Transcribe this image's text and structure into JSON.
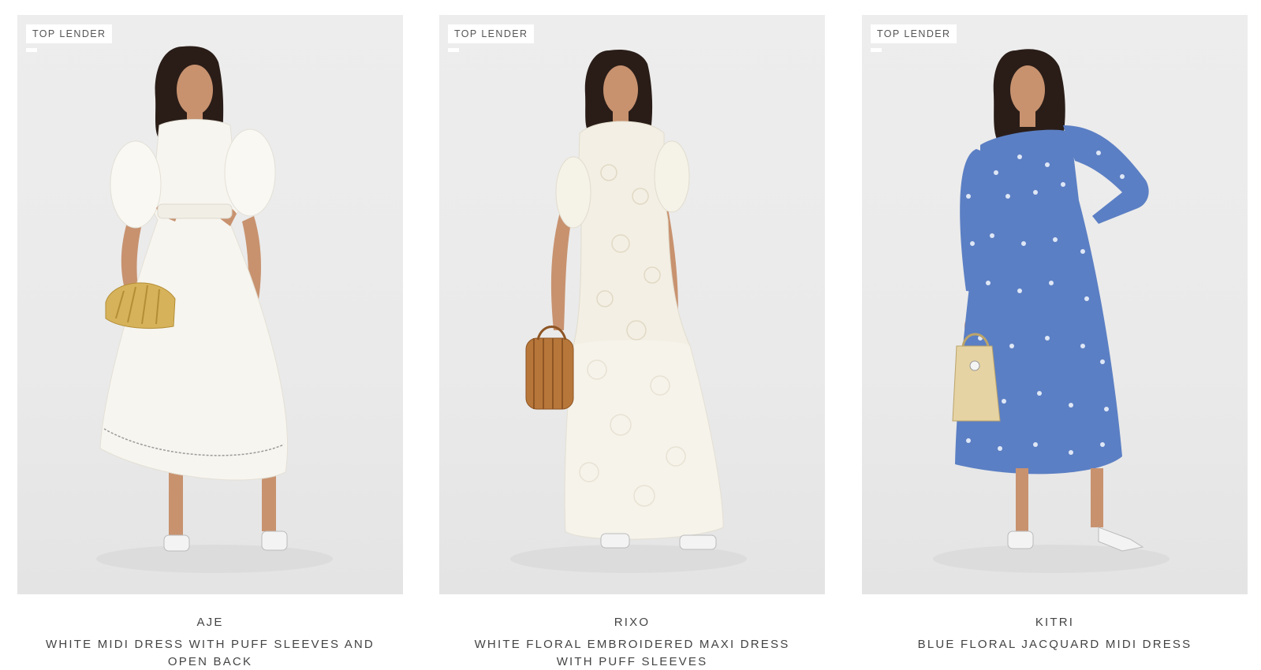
{
  "products": [
    {
      "badge": "TOP LENDER",
      "brand": "AJE",
      "title": "WHITE MIDI DRESS WITH PUFF SLEEVES AND OPEN BACK",
      "dress_color": "#f7f5ef",
      "accessory": "gold-shell-clutch"
    },
    {
      "badge": "TOP LENDER",
      "brand": "RIXO",
      "title": "WHITE FLORAL EMBROIDERED MAXI DRESS WITH PUFF SLEEVES",
      "dress_color": "#f3efe4",
      "accessory": "bamboo-basket-bag"
    },
    {
      "badge": "TOP LENDER",
      "brand": "KITRI",
      "title": "BLUE FLORAL JACQUARD MIDI DRESS",
      "dress_color": "#5b7fc4",
      "accessory": "straw-handbag"
    }
  ]
}
